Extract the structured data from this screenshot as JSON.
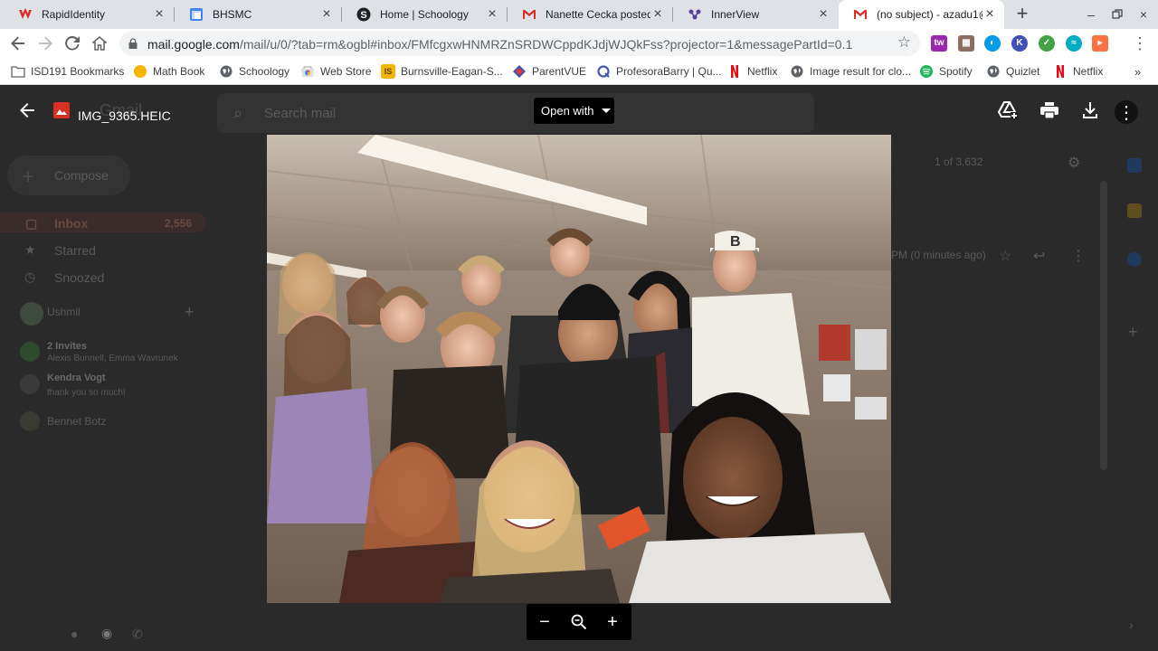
{
  "tabs": [
    {
      "title": "RapidIdentity",
      "icon": "rapididentity-icon",
      "color": "#d93025"
    },
    {
      "title": "BHSMC",
      "icon": "google-sites-icon",
      "color": "#4285f4"
    },
    {
      "title": "Home | Schoology",
      "icon": "schoology-icon",
      "color": "#202124"
    },
    {
      "title": "Nanette Cecka posted a",
      "icon": "gmail-icon",
      "color": "#d93025"
    },
    {
      "title": "InnerView",
      "icon": "innerview-icon",
      "color": "#5b3e9c"
    },
    {
      "title": "(no subject) - azadu1@",
      "icon": "gmail-icon",
      "color": "#d93025"
    }
  ],
  "toolbar": {
    "url_host": "mail.google.com",
    "url_path": "/mail/u/0/?tab=rm&ogbl#inbox/FMfcgxwHNMRZnSRDWCppdKJdjWJQkFss?projector=1&messagePartId=0.1"
  },
  "bookmarks": [
    {
      "label": "ISD191 Bookmarks",
      "icon": "folder-icon",
      "color": "#5f6368"
    },
    {
      "label": "Math Book",
      "icon": "circle-icon",
      "color": "#f4b400"
    },
    {
      "label": "Schoology",
      "icon": "globe-icon",
      "color": "#5f6368"
    },
    {
      "label": "Web Store",
      "icon": "webstore-icon",
      "color": "#ea4335"
    },
    {
      "label": "Burnsville-Eagan-S...",
      "icon": "isd-icon",
      "color": "#f4b400"
    },
    {
      "label": "ParentVUE",
      "icon": "parentvue-icon",
      "color": "#3f51b5"
    },
    {
      "label": "ProfesoraBarry | Qu...",
      "icon": "quizlet-q-icon",
      "color": "#4257b2"
    },
    {
      "label": "Netflix",
      "icon": "netflix-icon",
      "color": "#e50914"
    },
    {
      "label": "Image result for clo...",
      "icon": "globe-icon",
      "color": "#5f6368"
    },
    {
      "label": "Spotify",
      "icon": "spotify-icon",
      "color": "#1db954"
    },
    {
      "label": "Quizlet",
      "icon": "globe-icon",
      "color": "#5f6368"
    },
    {
      "label": "Netflix",
      "icon": "netflix-icon",
      "color": "#e50914"
    }
  ],
  "gmail_background": {
    "search_placeholder": "Search mail",
    "compose": "Compose",
    "inbox": "Inbox",
    "inbox_count": "2,556",
    "starred": "Starred",
    "snoozed": "Snoozed",
    "hangouts_user": "Ushmil",
    "invites_title": "2 Invites",
    "invites_names": "Alexis Bunnell, Emma Wavrunek",
    "contact_name": "Kendra Vogt",
    "contact_message": "thank you so much!",
    "contact_3": "Bennet Botz",
    "pagination": "1 of 3,632",
    "timestamp": "PM (0 minutes ago)",
    "gmail_logo": "Gmail"
  },
  "viewer": {
    "filename": "IMG_9365.HEIC",
    "open_with": "Open with",
    "photo_description_icon": "photo-image-icon"
  },
  "colors": {
    "viewer_bg": "#202124",
    "accent_red": "#d93025"
  }
}
